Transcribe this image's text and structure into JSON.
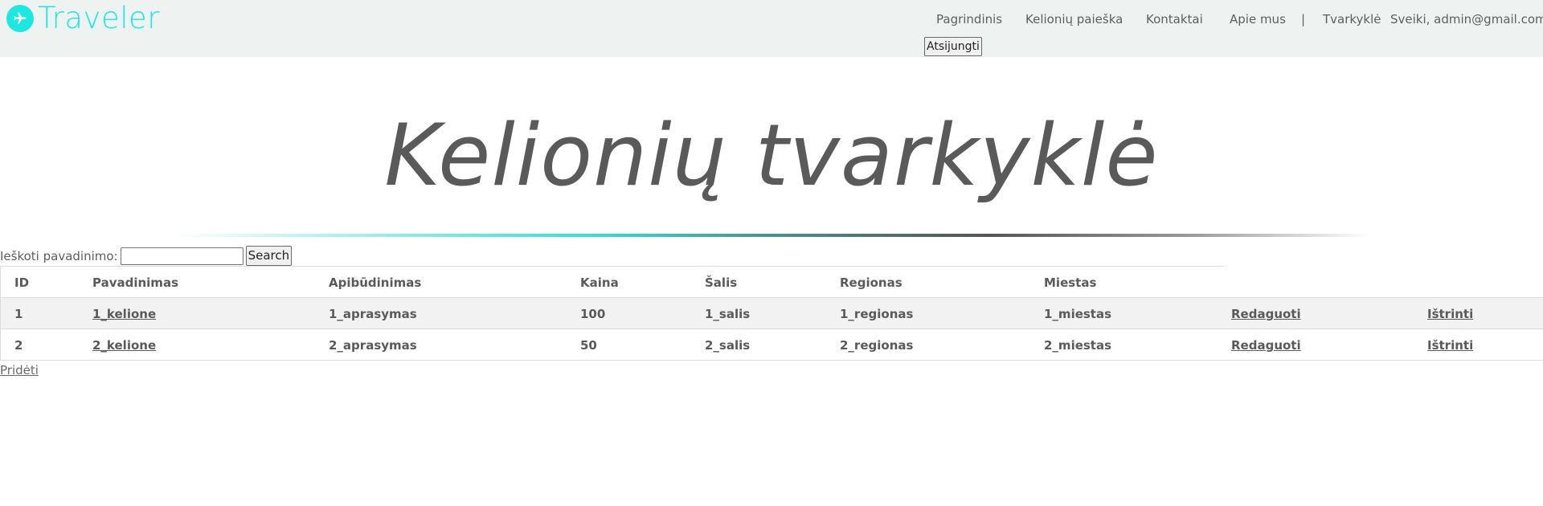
{
  "app": {
    "logo_text": "Traveler",
    "accent_color": "#1ee6e0"
  },
  "nav": {
    "items": [
      "Pagrindinis",
      "Kelionių paieška",
      "Kontaktai",
      "Apie mus"
    ],
    "separator": "|",
    "admin_link": "Tvarkyklė",
    "greeting": "Sveiki, admin@gmail.com!",
    "logout_label": "Atsijungti"
  },
  "page": {
    "title": "Kelionių tvarkyklė"
  },
  "search": {
    "label": "Ieškoti pavadinimo:",
    "value": "",
    "button_label": "Search"
  },
  "table": {
    "headers": [
      "ID",
      "Pavadinimas",
      "Apibūdinimas",
      "Kaina",
      "Šalis",
      "Regionas",
      "Miestas"
    ],
    "rows": [
      {
        "id": "1",
        "name": "1_kelione",
        "description": "1_aprasymas",
        "price": "100",
        "country": "1_salis",
        "region": "1_regionas",
        "city": "1_miestas",
        "edit": "Redaguoti",
        "delete": "Ištrinti"
      },
      {
        "id": "2",
        "name": "2_kelione",
        "description": "2_aprasymas",
        "price": "50",
        "country": "2_salis",
        "region": "2_regionas",
        "city": "2_miestas",
        "edit": "Redaguoti",
        "delete": "Ištrinti"
      }
    ],
    "row_colors": [
      "#f2f2f2",
      "#ffffff"
    ]
  },
  "add_link": "Pridėti"
}
